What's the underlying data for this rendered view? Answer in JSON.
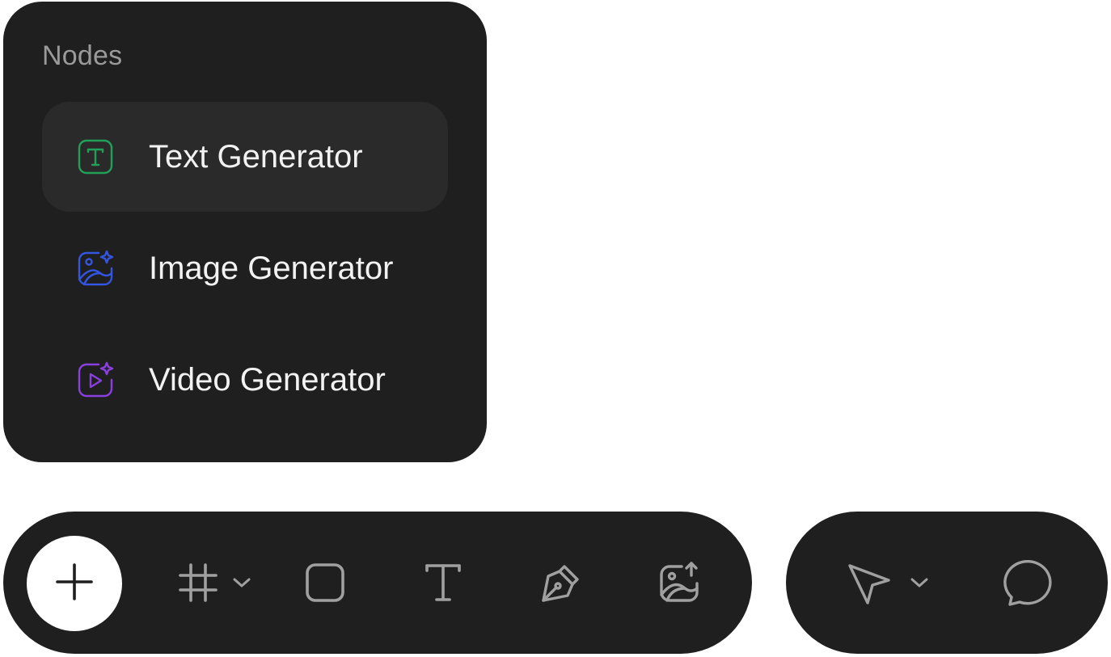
{
  "nodes_panel": {
    "title": "Nodes",
    "items": [
      {
        "label": "Text Generator",
        "icon": "text-box-icon",
        "color": "#22a05a",
        "active": true
      },
      {
        "label": "Image Generator",
        "icon": "image-sparkle-icon",
        "color": "#3355e0",
        "active": false
      },
      {
        "label": "Video Generator",
        "icon": "video-sparkle-icon",
        "color": "#8a3fe0",
        "active": false
      }
    ]
  },
  "toolbar": {
    "tools": [
      {
        "name": "add",
        "icon": "plus-icon"
      },
      {
        "name": "frame",
        "icon": "hash-icon",
        "has_dropdown": true
      },
      {
        "name": "rectangle",
        "icon": "square-icon"
      },
      {
        "name": "text",
        "icon": "type-icon"
      },
      {
        "name": "pen",
        "icon": "pen-nib-icon"
      },
      {
        "name": "upload-image",
        "icon": "image-upload-icon"
      }
    ],
    "side_tools": [
      {
        "name": "select",
        "icon": "cursor-arrow-icon",
        "has_dropdown": true
      },
      {
        "name": "comment",
        "icon": "speech-bubble-icon"
      }
    ]
  },
  "colors": {
    "panel_bg": "#1f1f1f",
    "active_item_bg": "#2a2a2a",
    "icon_gray": "#a0a0a0",
    "text_green": "#22a05a",
    "image_blue": "#3355e0",
    "video_purple": "#8a3fe0"
  }
}
